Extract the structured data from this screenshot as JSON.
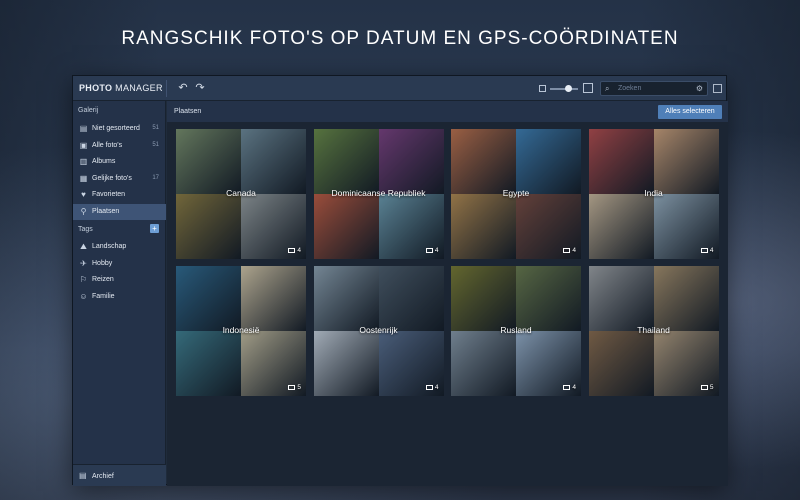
{
  "headline": "RANGSCHIK FOTO'S OP DATUM EN GPS-COÖRDINATEN",
  "app": {
    "logo_bold": "PHOTO",
    "logo_rest": " MANAGER",
    "undo_icon": "undo-icon",
    "redo_icon": "redo-icon"
  },
  "search": {
    "placeholder": "Zoeken"
  },
  "sidebar": {
    "section_gallery": "Galerij",
    "items": [
      {
        "label": "Niet gesorteerd",
        "count": "51",
        "icon": "unsorted-icon",
        "glyph": "▤"
      },
      {
        "label": "Alle foto's",
        "count": "51",
        "icon": "photos-icon",
        "glyph": "▣"
      },
      {
        "label": "Albums",
        "count": "",
        "icon": "albums-icon",
        "glyph": "▥"
      },
      {
        "label": "Gelijke foto's",
        "count": "17",
        "icon": "similar-icon",
        "glyph": "▦"
      },
      {
        "label": "Favorieten",
        "count": "",
        "icon": "heart-icon",
        "glyph": "♥"
      },
      {
        "label": "Plaatsen",
        "count": "",
        "icon": "pin-icon",
        "glyph": "⚲"
      }
    ],
    "section_tags": "Tags",
    "tags": [
      {
        "label": "Landschap",
        "icon": "landscape-icon",
        "glyph": "⛰"
      },
      {
        "label": "Hobby",
        "icon": "hobby-icon",
        "glyph": "✈"
      },
      {
        "label": "Reizen",
        "icon": "travel-icon",
        "glyph": "⚐"
      },
      {
        "label": "Familie",
        "icon": "family-icon",
        "glyph": "☺"
      }
    ],
    "archive": "Archief"
  },
  "main": {
    "title": "Plaatsen",
    "select_all": "Alles selecteren",
    "places": [
      {
        "name": "Canada",
        "count": "4",
        "colors": [
          "#7a8f6a",
          "#6f8a98",
          "#8c7a3e",
          "#9aa0a0"
        ]
      },
      {
        "name": "Dominicaanse Republiek",
        "count": "4",
        "colors": [
          "#6a8a44",
          "#7c3f7f",
          "#c05a3f",
          "#6e9db0"
        ]
      },
      {
        "name": "Egypte",
        "count": "4",
        "colors": [
          "#c0714a",
          "#3e7fb3",
          "#b58a4e",
          "#7a4a3e"
        ]
      },
      {
        "name": "India",
        "count": "4",
        "colors": [
          "#b44a4a",
          "#d0a27a",
          "#cdb89a",
          "#9ab0c0"
        ]
      },
      {
        "name": "Indonesië",
        "count": "5",
        "colors": [
          "#2f6a8f",
          "#d8c9a8",
          "#3f7f8f",
          "#c9bfa0"
        ]
      },
      {
        "name": "Oostenrijk",
        "count": "4",
        "colors": [
          "#8fa2b0",
          "#4d5c6a",
          "#c9d2dc",
          "#5a6f8f"
        ]
      },
      {
        "name": "Rusland",
        "count": "4",
        "colors": [
          "#7a7a2f",
          "#6a7a4a",
          "#8a9aa8",
          "#9ab2cc"
        ]
      },
      {
        "name": "Thailand",
        "count": "5",
        "colors": [
          "#a0a2a4",
          "#a88f6a",
          "#8a6a4a",
          "#b8a080"
        ]
      }
    ]
  }
}
